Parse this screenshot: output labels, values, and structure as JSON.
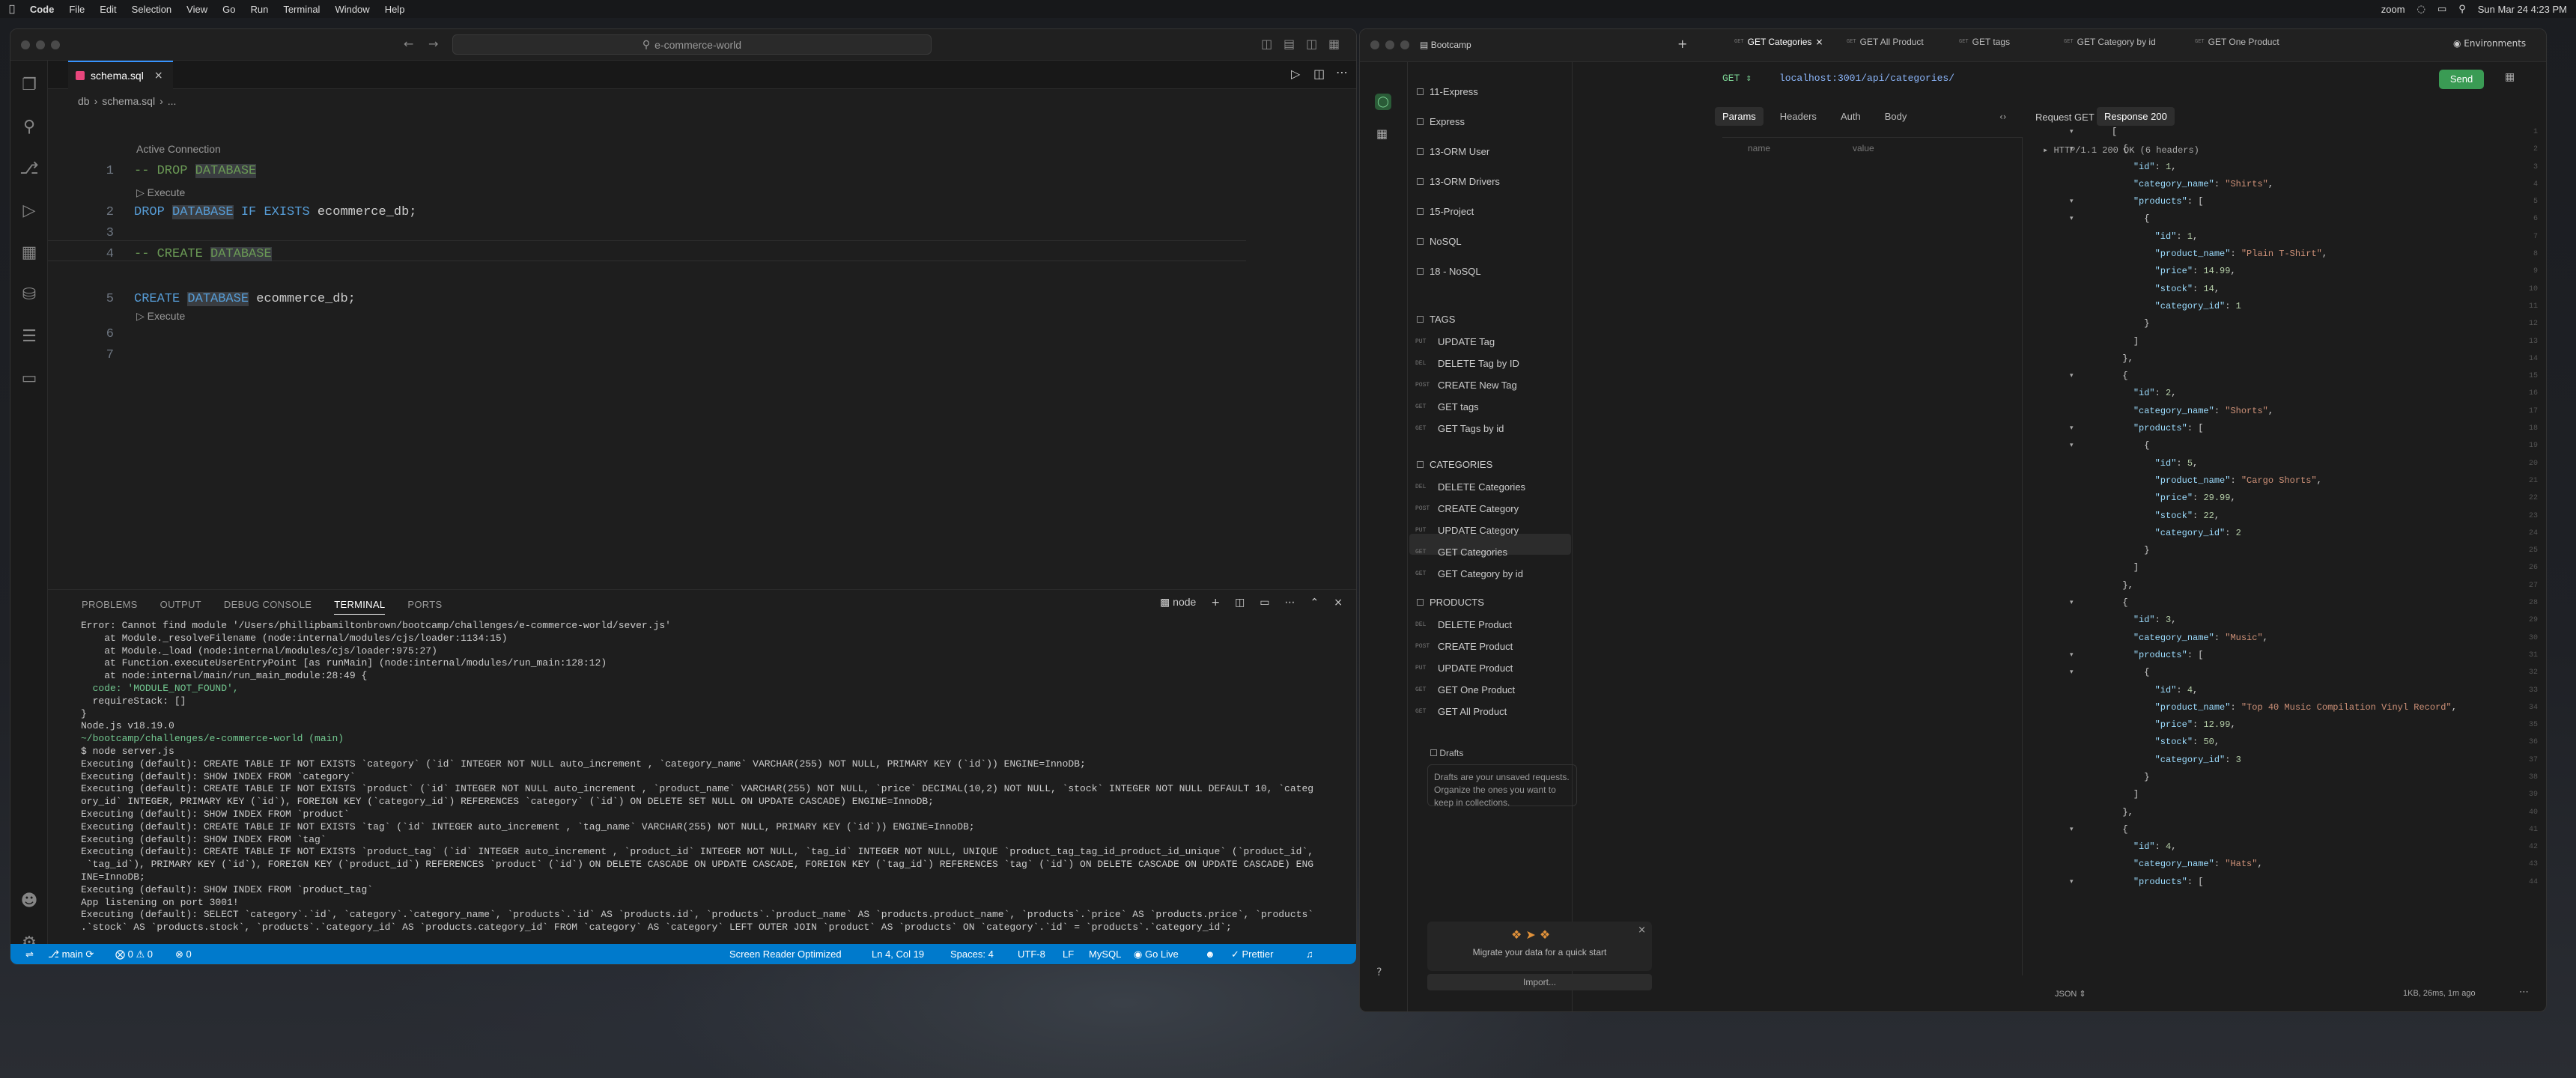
{
  "menubar": {
    "apple": "",
    "app": "Code",
    "items": [
      "File",
      "Edit",
      "Selection",
      "View",
      "Go",
      "Run",
      "Terminal",
      "Window",
      "Help"
    ],
    "clock": "Sun Mar 24  4:23 PM",
    "zoom": "zoom"
  },
  "vscode": {
    "search": "e-commerce-world",
    "tab": "schema.sql",
    "breadcrumb": [
      "db",
      "schema.sql",
      "..."
    ],
    "lenses": {
      "active": "Active Connection",
      "execute": "Execute"
    },
    "lines": [
      {
        "n": "1",
        "parts": [
          [
            "cm",
            "-- DROP "
          ],
          [
            "cmh",
            "DATABASE"
          ]
        ]
      },
      {
        "n": "2",
        "parts": [
          [
            "kw",
            "DROP "
          ],
          [
            "kwh",
            "DATABASE"
          ],
          [
            "kw",
            " IF EXISTS "
          ],
          [
            "tx",
            "ecommerce_db;"
          ]
        ]
      },
      {
        "n": "3",
        "parts": []
      },
      {
        "n": "4",
        "parts": [
          [
            "cm",
            "-- CREATE "
          ],
          [
            "cmh",
            "DATABASE"
          ]
        ]
      },
      {
        "n": "5",
        "parts": [
          [
            "kw",
            "CREATE "
          ],
          [
            "kwh",
            "DATABASE"
          ],
          [
            "tx",
            " ecommerce_db;"
          ]
        ]
      },
      {
        "n": "6",
        "parts": []
      },
      {
        "n": "7",
        "parts": []
      }
    ],
    "panel_tabs": [
      "PROBLEMS",
      "OUTPUT",
      "DEBUG CONSOLE",
      "TERMINAL",
      "PORTS"
    ],
    "terminal_shell": "node",
    "terminal": [
      "Error: Cannot find module '/Users/phillipbamiltonbrown/bootcamp/challenges/e-commerce-world/sever.js'",
      "    at Module._resolveFilename (node:internal/modules/cjs/loader:1134:15)",
      "    at Module._load (node:internal/modules/cjs/loader:975:27)",
      "    at Function.executeUserEntryPoint [as runMain] (node:internal/modules/run_main:128:12)",
      "    at node:internal/main/run_main_module:28:49 {",
      "  code: 'MODULE_NOT_FOUND',",
      "  requireStack: []",
      "}",
      "",
      "Node.js v18.19.0",
      "~/bootcamp/challenges/e-commerce-world (main)",
      "$ node server.js",
      "Executing (default): CREATE TABLE IF NOT EXISTS `category` (`id` INTEGER NOT NULL auto_increment , `category_name` VARCHAR(255) NOT NULL, PRIMARY KEY (`id`)) ENGINE=InnoDB;",
      "Executing (default): SHOW INDEX FROM `category`",
      "Executing (default): CREATE TABLE IF NOT EXISTS `product` (`id` INTEGER NOT NULL auto_increment , `product_name` VARCHAR(255) NOT NULL, `price` DECIMAL(10,2) NOT NULL, `stock` INTEGER NOT NULL DEFAULT 10, `categ",
      "ory_id` INTEGER, PRIMARY KEY (`id`), FOREIGN KEY (`category_id`) REFERENCES `category` (`id`) ON DELETE SET NULL ON UPDATE CASCADE) ENGINE=InnoDB;",
      "Executing (default): SHOW INDEX FROM `product`",
      "Executing (default): CREATE TABLE IF NOT EXISTS `tag` (`id` INTEGER auto_increment , `tag_name` VARCHAR(255) NOT NULL, PRIMARY KEY (`id`)) ENGINE=InnoDB;",
      "Executing (default): SHOW INDEX FROM `tag`",
      "Executing (default): CREATE TABLE IF NOT EXISTS `product_tag` (`id` INTEGER auto_increment , `product_id` INTEGER NOT NULL, `tag_id` INTEGER NOT NULL, UNIQUE `product_tag_tag_id_product_id_unique` (`product_id`,",
      " `tag_id`), PRIMARY KEY (`id`), FOREIGN KEY (`product_id`) REFERENCES `product` (`id`) ON DELETE CASCADE ON UPDATE CASCADE, FOREIGN KEY (`tag_id`) REFERENCES `tag` (`id`) ON DELETE CASCADE ON UPDATE CASCADE) ENG",
      "INE=InnoDB;",
      "Executing (default): SHOW INDEX FROM `product_tag`",
      "App listening on port 3001!",
      "Executing (default): SELECT `category`.`id`, `category`.`category_name`, `products`.`id` AS `products.id`, `products`.`product_name` AS `products.product_name`, `products`.`price` AS `products.price`, `products`",
      ".`stock` AS `products.stock`, `products`.`category_id` AS `products.category_id` FROM `category` AS `category` LEFT OUTER JOIN `product` AS `products` ON `category`.`id` = `products`.`category_id`;"
    ],
    "status": {
      "branch": "main",
      "problems": "0 ⚠ 0",
      "ports": "0",
      "reader": "Screen Reader Optimized",
      "pos": "Ln 4, Col 19",
      "spaces": "Spaces: 4",
      "enc": "UTF-8",
      "eol": "LF",
      "lang": "MySQL",
      "live": "Go Live",
      "prettier": "Prettier"
    }
  },
  "postman": {
    "workspace": "Bootcamp",
    "tabs": [
      "GET Categories",
      "GET All Product",
      "GET tags",
      "GET Category by id",
      "GET One Product"
    ],
    "environments": "Environments",
    "collections": [
      {
        "name": "11-Express"
      },
      {
        "name": "Express"
      },
      {
        "name": "13-ORM User"
      },
      {
        "name": "13-ORM Drivers"
      },
      {
        "name": "15-Project"
      },
      {
        "name": "NoSQL"
      },
      {
        "name": "18 - NoSQL"
      }
    ],
    "tags_folder": "TAGS",
    "tags": [
      [
        "PUT",
        "UPDATE Tag"
      ],
      [
        "DEL",
        "DELETE Tag by ID"
      ],
      [
        "POST",
        "CREATE New Tag"
      ],
      [
        "GET",
        "GET tags"
      ],
      [
        "GET",
        "GET Tags by id"
      ]
    ],
    "categories_folder": "CATEGORIES",
    "categories": [
      [
        "DEL",
        "DELETE Categories"
      ],
      [
        "POST",
        "CREATE Category"
      ],
      [
        "PUT",
        "UPDATE Category"
      ],
      [
        "GET",
        "GET Categories"
      ],
      [
        "GET",
        "GET Category by id"
      ]
    ],
    "products_folder": "PRODUCTS",
    "products": [
      [
        "DEL",
        "DELETE Product"
      ],
      [
        "POST",
        "CREATE Product"
      ],
      [
        "PUT",
        "UPDATE Product"
      ],
      [
        "GET",
        "GET One Product"
      ],
      [
        "GET",
        "GET All Product"
      ]
    ],
    "drafts": "Drafts",
    "drafts_text": "Drafts are your unsaved requests. Organize the ones you want to keep in collections.",
    "migrate": "Migrate your data for a quick start",
    "import": "Import...",
    "method": "GET",
    "url": "localhost:3001/api/categories/",
    "send": "Send",
    "req_tabs": [
      "Params",
      "Headers",
      "Auth",
      "Body"
    ],
    "req_label": "Request GET",
    "resp_label": "Response 200",
    "param_cols": [
      "name",
      "value"
    ],
    "http": "HTTP/1.1 200 OK (6 headers)",
    "format": "JSON",
    "meta": "1KB, 26ms, 1m ago"
  },
  "response_json": [
    [
      {
        "i": 0,
        "t": "["
      }
    ],
    [
      {
        "i": 1,
        "t": "{"
      }
    ],
    [
      {
        "i": 2,
        "k": "\"id\"",
        "v": "1",
        "c": "n"
      }
    ],
    [
      {
        "i": 2,
        "k": "\"category_name\"",
        "v": "\"Shirts\"",
        "c": "s"
      }
    ],
    [
      {
        "i": 2,
        "k": "\"products\"",
        "t": "["
      }
    ],
    [
      {
        "i": 3,
        "t": "{"
      }
    ],
    [
      {
        "i": 4,
        "k": "\"id\"",
        "v": "1",
        "c": "n"
      }
    ],
    [
      {
        "i": 4,
        "k": "\"product_name\"",
        "v": "\"Plain T-Shirt\"",
        "c": "s"
      }
    ],
    [
      {
        "i": 4,
        "k": "\"price\"",
        "v": "14.99",
        "c": "n"
      }
    ],
    [
      {
        "i": 4,
        "k": "\"stock\"",
        "v": "14",
        "c": "n"
      }
    ],
    [
      {
        "i": 4,
        "k": "\"category_id\"",
        "v": "1",
        "c": "n",
        "last": true
      }
    ],
    [
      {
        "i": 3,
        "t": "}"
      }
    ],
    [
      {
        "i": 2,
        "t": "]"
      }
    ],
    [
      {
        "i": 1,
        "t": "},"
      }
    ],
    [
      {
        "i": 1,
        "t": "{"
      }
    ],
    [
      {
        "i": 2,
        "k": "\"id\"",
        "v": "2",
        "c": "n"
      }
    ],
    [
      {
        "i": 2,
        "k": "\"category_name\"",
        "v": "\"Shorts\"",
        "c": "s"
      }
    ],
    [
      {
        "i": 2,
        "k": "\"products\"",
        "t": "["
      }
    ],
    [
      {
        "i": 3,
        "t": "{"
      }
    ],
    [
      {
        "i": 4,
        "k": "\"id\"",
        "v": "5",
        "c": "n"
      }
    ],
    [
      {
        "i": 4,
        "k": "\"product_name\"",
        "v": "\"Cargo Shorts\"",
        "c": "s"
      }
    ],
    [
      {
        "i": 4,
        "k": "\"price\"",
        "v": "29.99",
        "c": "n"
      }
    ],
    [
      {
        "i": 4,
        "k": "\"stock\"",
        "v": "22",
        "c": "n"
      }
    ],
    [
      {
        "i": 4,
        "k": "\"category_id\"",
        "v": "2",
        "c": "n",
        "last": true
      }
    ],
    [
      {
        "i": 3,
        "t": "}"
      }
    ],
    [
      {
        "i": 2,
        "t": "]"
      }
    ],
    [
      {
        "i": 1,
        "t": "},"
      }
    ],
    [
      {
        "i": 1,
        "t": "{"
      }
    ],
    [
      {
        "i": 2,
        "k": "\"id\"",
        "v": "3",
        "c": "n"
      }
    ],
    [
      {
        "i": 2,
        "k": "\"category_name\"",
        "v": "\"Music\"",
        "c": "s"
      }
    ],
    [
      {
        "i": 2,
        "k": "\"products\"",
        "t": "["
      }
    ],
    [
      {
        "i": 3,
        "t": "{"
      }
    ],
    [
      {
        "i": 4,
        "k": "\"id\"",
        "v": "4",
        "c": "n"
      }
    ],
    [
      {
        "i": 4,
        "k": "\"product_name\"",
        "v": "\"Top 40 Music Compilation Vinyl Record\"",
        "c": "s"
      }
    ],
    [
      {
        "i": 4,
        "k": "\"price\"",
        "v": "12.99",
        "c": "n"
      }
    ],
    [
      {
        "i": 4,
        "k": "\"stock\"",
        "v": "50",
        "c": "n"
      }
    ],
    [
      {
        "i": 4,
        "k": "\"category_id\"",
        "v": "3",
        "c": "n",
        "last": true
      }
    ],
    [
      {
        "i": 3,
        "t": "}"
      }
    ],
    [
      {
        "i": 2,
        "t": "]"
      }
    ],
    [
      {
        "i": 1,
        "t": "},"
      }
    ],
    [
      {
        "i": 1,
        "t": "{"
      }
    ],
    [
      {
        "i": 2,
        "k": "\"id\"",
        "v": "4",
        "c": "n"
      }
    ],
    [
      {
        "i": 2,
        "k": "\"category_name\"",
        "v": "\"Hats\"",
        "c": "s"
      }
    ],
    [
      {
        "i": 2,
        "k": "\"products\"",
        "t": "["
      }
    ]
  ],
  "colors": {
    "accent": "#007acc",
    "send": "#3a9b54",
    "tabline": "#3794ff"
  }
}
